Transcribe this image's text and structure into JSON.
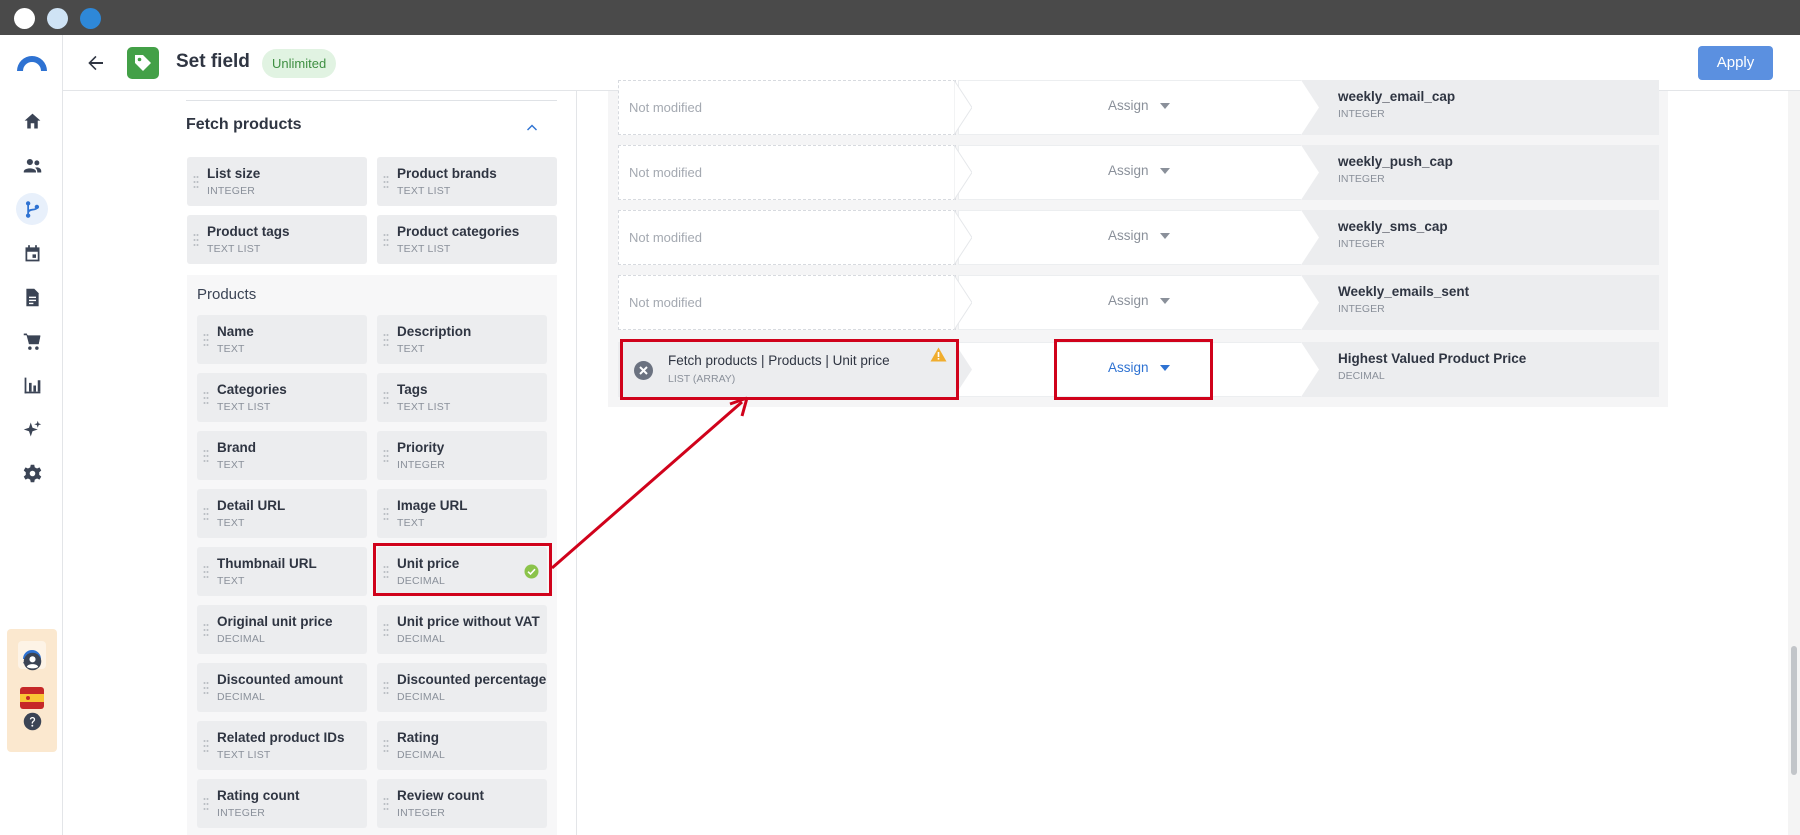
{
  "header": {
    "title": "Set field",
    "plan_badge": "Unlimited",
    "apply_label": "Apply"
  },
  "icons": {
    "rail": [
      "home-icon",
      "people-icon",
      "journey-icon",
      "calendar-icon",
      "document-icon",
      "cart-icon",
      "analytics-icon",
      "sparkle-icon",
      "settings-icon",
      "account-icon",
      "help-icon"
    ],
    "header": [
      "back-arrow-icon",
      "tag-icon"
    ]
  },
  "colors": {
    "accent": "#2e72d2",
    "apply": "#5b90e0",
    "tag_badge": "#43a047",
    "annotation": "#d0021b",
    "warning": "#f0ad2e"
  },
  "left_panel": {
    "section_title": "Fetch products",
    "fetch_fields": [
      {
        "name": "List size",
        "type": "INTEGER"
      },
      {
        "name": "Product brands",
        "type": "TEXT LIST"
      },
      {
        "name": "Product tags",
        "type": "TEXT LIST"
      },
      {
        "name": "Product categories",
        "type": "TEXT LIST"
      }
    ],
    "products_title": "Products",
    "product_fields": [
      {
        "name": "Name",
        "type": "TEXT"
      },
      {
        "name": "Description",
        "type": "TEXT"
      },
      {
        "name": "Categories",
        "type": "TEXT LIST"
      },
      {
        "name": "Tags",
        "type": "TEXT LIST"
      },
      {
        "name": "Brand",
        "type": "TEXT"
      },
      {
        "name": "Priority",
        "type": "INTEGER"
      },
      {
        "name": "Detail URL",
        "type": "TEXT"
      },
      {
        "name": "Image URL",
        "type": "TEXT"
      },
      {
        "name": "Thumbnail URL",
        "type": "TEXT"
      },
      {
        "name": "Unit price",
        "type": "DECIMAL"
      },
      {
        "name": "Original unit price",
        "type": "DECIMAL"
      },
      {
        "name": "Unit price without VAT",
        "type": "DECIMAL"
      },
      {
        "name": "Discounted amount",
        "type": "DECIMAL"
      },
      {
        "name": "Discounted percentage",
        "type": "DECIMAL"
      },
      {
        "name": "Related product IDs",
        "type": "TEXT LIST"
      },
      {
        "name": "Rating",
        "type": "DECIMAL"
      },
      {
        "name": "Rating count",
        "type": "INTEGER"
      },
      {
        "name": "Review count",
        "type": "INTEGER"
      }
    ]
  },
  "mapping": {
    "rows": [
      {
        "source": "Not modified",
        "operation": "Assign",
        "target": "weekly_email_cap",
        "target_type": "INTEGER"
      },
      {
        "source": "Not modified",
        "operation": "Assign",
        "target": "weekly_push_cap",
        "target_type": "INTEGER"
      },
      {
        "source": "Not modified",
        "operation": "Assign",
        "target": "weekly_sms_cap",
        "target_type": "INTEGER"
      },
      {
        "source": "Not modified",
        "operation": "Assign",
        "target": "Weekly_emails_sent",
        "target_type": "INTEGER"
      }
    ],
    "active_row": {
      "source": "Fetch products | Products | Unit price",
      "source_type": "LIST (ARRAY)",
      "operation": "Assign",
      "target": "Highest Valued Product Price",
      "target_type": "DECIMAL"
    }
  }
}
